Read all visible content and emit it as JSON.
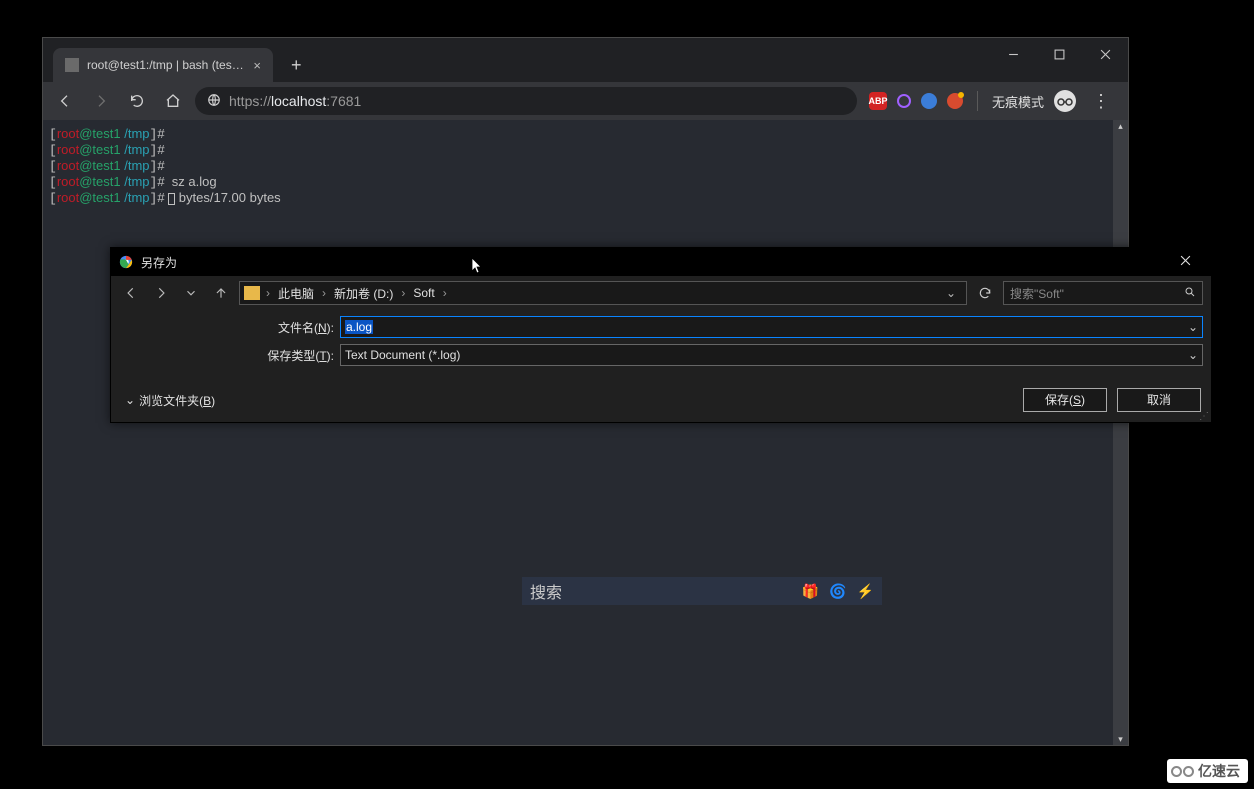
{
  "browser": {
    "tab": {
      "title": "root@test1:/tmp | bash (test1..."
    },
    "window_controls": {
      "min": "–",
      "max": "▢",
      "close": "✕"
    },
    "url": {
      "scheme": "https://",
      "host": "localhost",
      "port": ":7681"
    },
    "incognito_label": "无痕模式",
    "extensions": {
      "abp": "ABP"
    }
  },
  "terminal": {
    "lines": [
      {
        "user": "root",
        "at": "@test1 ",
        "path": "/tmp",
        "prompt": "]#",
        "cmd": ""
      },
      {
        "user": "root",
        "at": "@test1 ",
        "path": "/tmp",
        "prompt": "]#",
        "cmd": ""
      },
      {
        "user": "root",
        "at": "@test1 ",
        "path": "/tmp",
        "prompt": "]#",
        "cmd": ""
      },
      {
        "user": "root",
        "at": "@test1 ",
        "path": "/tmp",
        "prompt": "]#",
        "cmd": " sz a.log"
      },
      {
        "user": "root",
        "at": "@test1 ",
        "path": "/tmp",
        "prompt": "]#",
        "cmd": " ",
        "tail": "bytes/17.00 bytes",
        "cursor": true
      }
    ]
  },
  "save_dialog": {
    "title": "另存为",
    "breadcrumb": [
      "此电脑",
      "新加卷 (D:)",
      "Soft"
    ],
    "search_placeholder": "搜索\"Soft\"",
    "labels": {
      "filename": "文件名(",
      "filename_key": "N",
      "filename_suf": "):",
      "type": "保存类型(",
      "type_key": "T",
      "type_suf": "):",
      "browse_pre": "浏览文件夹(",
      "browse_key": "B",
      "browse_suf": ")"
    },
    "filename": "a.log",
    "filetype": "Text Document (*.log)",
    "buttons": {
      "save": "保存(",
      "save_key": "S",
      "save_suf": ")",
      "cancel": "取消"
    }
  },
  "floating_bar": {
    "label": "搜索"
  },
  "watermark": {
    "text": "亿速云"
  }
}
